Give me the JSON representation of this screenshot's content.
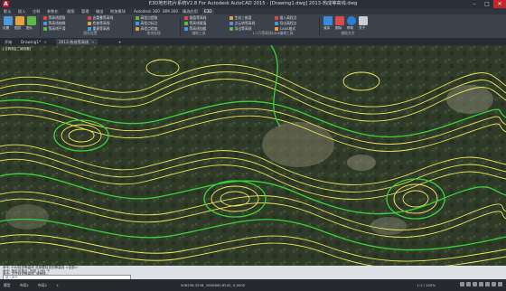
{
  "window": {
    "title": "E3D地形拓片系统V2.8 For Autodesk AutoCAD 2015 - [Drawing1.dwg]   2013-热成等高线.dwg",
    "logo": "A",
    "controls": [
      "–",
      "□",
      "✕"
    ]
  },
  "ribbon_tabs": [
    "默认",
    "插入",
    "注释",
    "参数化",
    "视图",
    "管理",
    "输出",
    "附加模块",
    "Autodesk 360",
    "BIM 360",
    "精选应用",
    "E3D"
  ],
  "ribbon": {
    "big_left": [
      {
        "label": "设置",
        "color": "#4a9ad8"
      },
      {
        "label": "图层",
        "color": "#e6a23c"
      },
      {
        "label": "图片",
        "color": "#5fb848"
      }
    ],
    "cols": [
      [
        "等高线提取",
        "等高线抽稀",
        "等高线平滑"
      ],
      [
        "去重叠等高线",
        "检查等高线",
        "重建等高线"
      ],
      [
        "高程点提取",
        "高程点标注",
        "高程点检查"
      ],
      [
        "插值等高线",
        "等高线赋值",
        "等高线加粗"
      ],
      [
        "生成三维面",
        "点云转等高线",
        "导出等高线"
      ],
      [
        "插入高程点",
        "导出高程点",
        "CASS格式"
      ]
    ],
    "big_right": [
      {
        "label": "渲染",
        "color": "#3a8be0"
      },
      {
        "label": "删除",
        "color": "#d94b4b"
      },
      {
        "label": "帮助",
        "color": "#2c7fd0"
      },
      {
        "label": "关于",
        "color": "#c9cdd3"
      }
    ],
    "panels": [
      "图形设置",
      "地块处理",
      "辅助工具",
      "1:2万等高线DEM编辑工具",
      "辅助文字"
    ]
  },
  "file_tabs": [
    {
      "label": "开始",
      "active": false
    },
    {
      "label": "Drawing1*",
      "active": false
    },
    {
      "label": "2013-热成等高线",
      "active": true
    }
  ],
  "viewport_label": "[-][俯视][二维线框]",
  "command": {
    "lines": [
      "命令: E3D检查等高线 选择要检查的等高线 <全部>:",
      "命令: 指定对角点: 找到 1260 个",
      "命令: 正在检查等高线, 请稍候..."
    ],
    "placeholder": "键入命令"
  },
  "layout_tabs": [
    "模型",
    "布局1",
    "布局2"
  ],
  "status": {
    "coords": "506236.3538, 2650800.6542, 0.0000",
    "mode": "模型",
    "scale": "1:1 / 100%"
  }
}
